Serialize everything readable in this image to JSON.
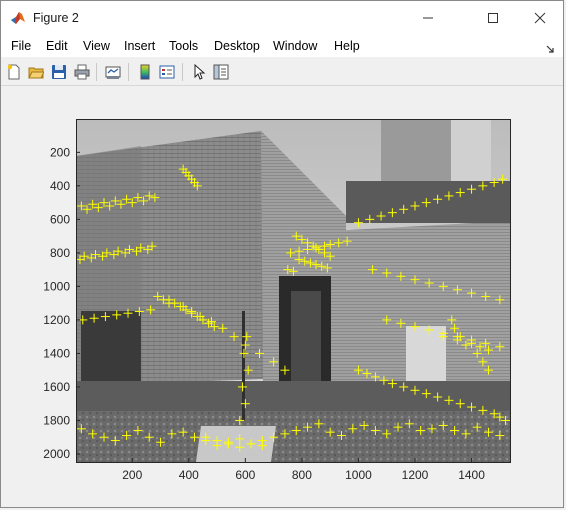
{
  "window": {
    "title": "Figure 2",
    "icon": "matlab-logo-icon"
  },
  "window_controls": {
    "minimize": "minimize-icon",
    "maximize": "maximize-icon",
    "close": "close-icon"
  },
  "menu": {
    "items": [
      "File",
      "Edit",
      "View",
      "Insert",
      "Tools",
      "Desktop",
      "Window",
      "Help"
    ]
  },
  "toolbar": {
    "buttons": [
      "new-figure-icon",
      "open-file-icon",
      "save-figure-icon",
      "print-figure-icon",
      "link-plot-icon",
      "insert-colorbar-icon",
      "insert-legend-icon",
      "edit-plot-arrow-icon",
      "property-inspector-icon"
    ]
  },
  "colors": {
    "marker": "#ffff00",
    "axes_background": "#ffffff",
    "figure_background": "#f0f0f0"
  },
  "chart_data": {
    "type": "scatter",
    "description_marks": "plus markers over grayscale building photo",
    "title": "",
    "xlabel": "",
    "ylabel": "",
    "xlim": [
      1,
      1536
    ],
    "ylim": [
      1,
      2048
    ],
    "y_reversed": true,
    "xticks": [
      200,
      400,
      600,
      800,
      1000,
      1200,
      1400
    ],
    "yticks": [
      200,
      400,
      600,
      800,
      1000,
      1200,
      1400,
      1600,
      1800,
      2000
    ],
    "grid": false,
    "marker": "+",
    "series": [
      {
        "values_x": [
          20,
          60,
          100,
          140,
          180,
          220,
          260,
          40,
          80,
          120,
          160,
          200,
          240,
          280,
          30,
          70,
          110,
          150,
          190,
          230,
          270,
          15,
          55,
          95,
          135,
          175,
          215,
          255,
          25,
          65,
          105,
          145,
          185,
          225,
          265,
          290,
          310,
          330,
          380,
          410,
          440,
          480,
          520,
          560,
          600,
          650,
          700,
          740,
          760,
          790,
          820,
          850,
          880,
          900,
          930,
          960,
          1000,
          1040,
          1080,
          1120,
          1160,
          1200,
          1240,
          1280,
          1320,
          1360,
          1400,
          1440,
          1480,
          1510,
          330,
          350,
          370,
          390,
          410,
          430,
          450,
          470,
          490,
          1100,
          1150,
          1200,
          1250,
          1300,
          1350,
          1400,
          1450,
          1500,
          1050,
          1100,
          1150,
          1200,
          1250,
          1300,
          1350,
          1400,
          1450,
          1500,
          20,
          60,
          100,
          140,
          180,
          220,
          260,
          300,
          340,
          380,
          420,
          460,
          500,
          540,
          580,
          620,
          660,
          700,
          740,
          780,
          820,
          860,
          900,
          940,
          980,
          1020,
          1060,
          1100,
          1140,
          1180,
          1220,
          1260,
          1300,
          1340,
          1380,
          1420,
          1460,
          1500,
          460,
          500,
          540,
          580,
          620,
          660,
          580,
          600,
          590,
          610,
          595,
          605,
          1000,
          1030,
          1060,
          1090,
          1120,
          1160,
          1200,
          1240,
          1280,
          1320,
          1360,
          1400,
          1440,
          1480,
          1500,
          1520,
          780,
          800,
          820,
          840,
          860,
          880,
          900,
          790,
          810,
          830,
          850,
          870,
          890,
          750,
          770,
          1300,
          1350,
          1400,
          1430,
          1460,
          380,
          390,
          400,
          410,
          420,
          430,
          1330,
          1340,
          1360,
          1380,
          1420,
          1440,
          1460
        ],
        "values_y": [
          520,
          510,
          500,
          490,
          480,
          470,
          460,
          540,
          530,
          520,
          510,
          500,
          490,
          470,
          820,
          810,
          800,
          790,
          780,
          770,
          760,
          840,
          830,
          820,
          810,
          800,
          790,
          780,
          1200,
          1190,
          1180,
          1170,
          1160,
          1150,
          1140,
          1060,
          1080,
          1100,
          1120,
          1150,
          1180,
          1210,
          1250,
          1300,
          1350,
          1400,
          1450,
          1500,
          800,
          790,
          780,
          770,
          760,
          750,
          740,
          730,
          620,
          600,
          580,
          560,
          540,
          520,
          500,
          480,
          460,
          440,
          420,
          400,
          380,
          360,
          1080,
          1100,
          1120,
          1140,
          1160,
          1180,
          1200,
          1220,
          1240,
          1200,
          1220,
          1240,
          1260,
          1280,
          1300,
          1320,
          1340,
          1360,
          900,
          920,
          940,
          960,
          980,
          1000,
          1020,
          1040,
          1060,
          1080,
          1850,
          1880,
          1900,
          1920,
          1890,
          1860,
          1900,
          1930,
          1880,
          1870,
          1900,
          1920,
          1950,
          1930,
          1910,
          1940,
          1950,
          1900,
          1880,
          1860,
          1840,
          1820,
          1870,
          1890,
          1850,
          1830,
          1860,
          1880,
          1840,
          1820,
          1860,
          1850,
          1830,
          1860,
          1880,
          1840,
          1870,
          1890,
          1900,
          1920,
          1940,
          1960,
          1940,
          1920,
          1800,
          1700,
          1600,
          1500,
          1400,
          1300,
          1500,
          1520,
          1540,
          1560,
          1580,
          1600,
          1620,
          1640,
          1660,
          1680,
          1700,
          1720,
          1740,
          1760,
          1780,
          1800,
          700,
          720,
          740,
          760,
          780,
          800,
          820,
          840,
          850,
          860,
          870,
          880,
          890,
          900,
          910,
          1300,
          1320,
          1340,
          1360,
          1380,
          300,
          320,
          340,
          360,
          380,
          400,
          1200,
          1250,
          1300,
          1350,
          1400,
          1450,
          1500
        ]
      }
    ]
  }
}
